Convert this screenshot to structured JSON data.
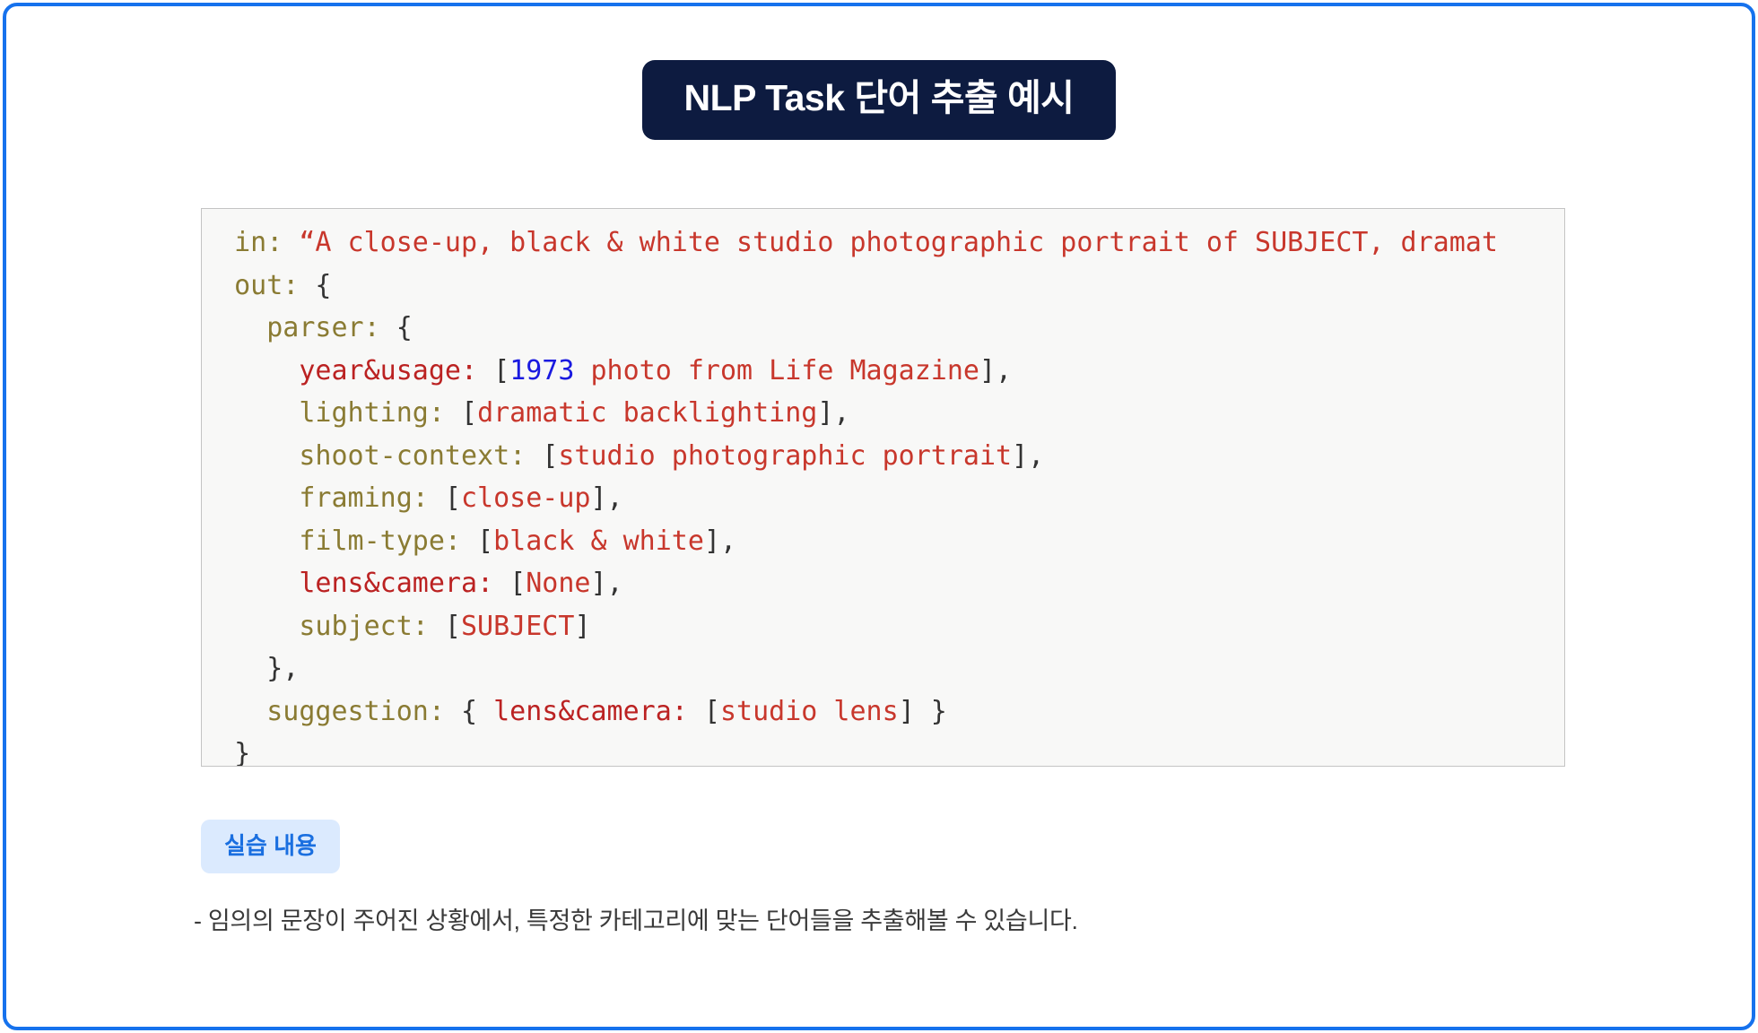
{
  "page": {
    "border_color": "#1672ed",
    "background": "#ffffff"
  },
  "title": {
    "text": "NLP Task 단어 추출 예시",
    "background": "#0d1b40",
    "color": "#ffffff"
  },
  "code_block": {
    "background": "#f8f8f7",
    "border_color": "#c4c4c4",
    "note": "first line is clipped at the right edge of the block",
    "colors": {
      "key": "#8a7b33",
      "key_red": "#bb2222",
      "string": "#c8372c",
      "number": "#1a1ae0",
      "punct": "#333333"
    },
    "lines": [
      {
        "indent": "  ",
        "tokens": [
          {
            "t": "in:",
            "c": "key"
          },
          {
            "t": " ",
            "c": "plain"
          },
          {
            "t": "“A close-up, black & white studio photographic portrait of SUBJECT, dramat",
            "c": "str"
          }
        ]
      },
      {
        "indent": "  ",
        "tokens": [
          {
            "t": "out:",
            "c": "key"
          },
          {
            "t": " {",
            "c": "punct"
          }
        ]
      },
      {
        "indent": "    ",
        "tokens": [
          {
            "t": "parser:",
            "c": "key"
          },
          {
            "t": " {",
            "c": "punct"
          }
        ]
      },
      {
        "indent": "      ",
        "tokens": [
          {
            "t": "year&usage:",
            "c": "key_red"
          },
          {
            "t": " [",
            "c": "punct"
          },
          {
            "t": "1973",
            "c": "num"
          },
          {
            "t": " photo from Life Magazine",
            "c": "str"
          },
          {
            "t": "],",
            "c": "punct"
          }
        ]
      },
      {
        "indent": "      ",
        "tokens": [
          {
            "t": "lighting:",
            "c": "key"
          },
          {
            "t": " [",
            "c": "punct"
          },
          {
            "t": "dramatic backlighting",
            "c": "str"
          },
          {
            "t": "],",
            "c": "punct"
          }
        ]
      },
      {
        "indent": "      ",
        "tokens": [
          {
            "t": "shoot-context:",
            "c": "key"
          },
          {
            "t": " [",
            "c": "punct"
          },
          {
            "t": "studio photographic portrait",
            "c": "str"
          },
          {
            "t": "],",
            "c": "punct"
          }
        ]
      },
      {
        "indent": "      ",
        "tokens": [
          {
            "t": "framing:",
            "c": "key"
          },
          {
            "t": " [",
            "c": "punct"
          },
          {
            "t": "close-up",
            "c": "str"
          },
          {
            "t": "],",
            "c": "punct"
          }
        ]
      },
      {
        "indent": "      ",
        "tokens": [
          {
            "t": "film-type:",
            "c": "key"
          },
          {
            "t": " [",
            "c": "punct"
          },
          {
            "t": "black & white",
            "c": "str"
          },
          {
            "t": "],",
            "c": "punct"
          }
        ]
      },
      {
        "indent": "      ",
        "tokens": [
          {
            "t": "lens&camera:",
            "c": "key_red"
          },
          {
            "t": " [",
            "c": "punct"
          },
          {
            "t": "None",
            "c": "str"
          },
          {
            "t": "],",
            "c": "punct"
          }
        ]
      },
      {
        "indent": "      ",
        "tokens": [
          {
            "t": "subject:",
            "c": "key"
          },
          {
            "t": " [",
            "c": "punct"
          },
          {
            "t": "SUBJECT",
            "c": "str"
          },
          {
            "t": "]",
            "c": "punct"
          }
        ]
      },
      {
        "indent": "    ",
        "tokens": [
          {
            "t": "},",
            "c": "punct"
          }
        ]
      },
      {
        "indent": "    ",
        "tokens": [
          {
            "t": "suggestion:",
            "c": "key"
          },
          {
            "t": " { ",
            "c": "punct"
          },
          {
            "t": "lens&camera:",
            "c": "key_red"
          },
          {
            "t": " [",
            "c": "punct"
          },
          {
            "t": "studio lens",
            "c": "str"
          },
          {
            "t": "] }",
            "c": "punct"
          }
        ]
      },
      {
        "indent": "  ",
        "tokens": [
          {
            "t": "}",
            "c": "punct"
          }
        ]
      }
    ]
  },
  "practice": {
    "label": "실습 내용",
    "background": "#dbeafe",
    "color": "#1a6fe0"
  },
  "description": {
    "text": "- 임의의 문장이 주어진 상황에서, 특정한 카테고리에 맞는 단어들을 추출해볼 수 있습니다."
  }
}
